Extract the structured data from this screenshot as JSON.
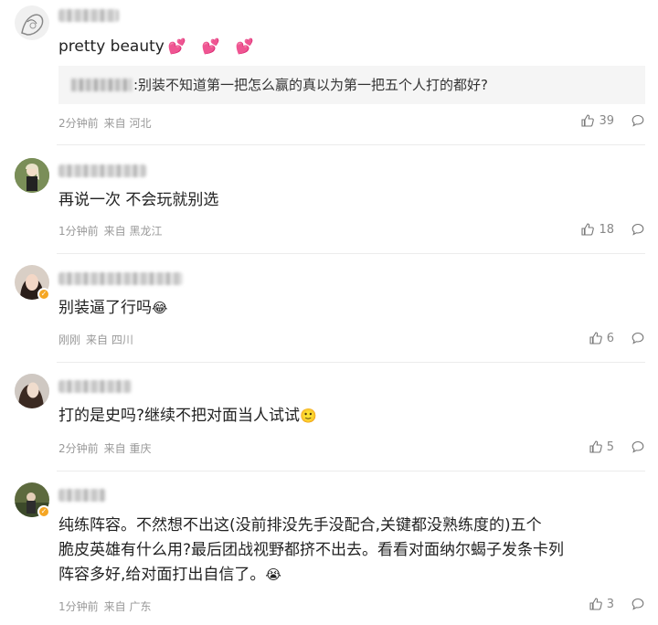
{
  "comments": [
    {
      "text": "pretty beauty",
      "hearts": "💕 💕 💕",
      "reply": ":别装不知道第一把怎么赢的真以为第一把五个人打的都好?",
      "time": "2分钟前",
      "from": "来自 河北",
      "likes": "39"
    },
    {
      "text": "再说一次 不会玩就别选",
      "time": "1分钟前",
      "from": "来自 黑龙江",
      "likes": "18"
    },
    {
      "text": "别装逼了行吗",
      "emoji": "😂",
      "time": "刚刚",
      "from": "来自 四川",
      "likes": "6"
    },
    {
      "text": "打的是史吗?继续不把对面当人试试",
      "emoji": "🙂",
      "time": "2分钟前",
      "from": "来自 重庆",
      "likes": "5"
    },
    {
      "text_lines": [
        "纯练阵容。不然想不出这(没前排没先手没配合,关键都没熟练度的)五个",
        "脆皮英雄有什么用?最后团战视野都挤不出去。看看对面纳尔蝎子发条卡列",
        "阵容多好,给对面打出自信了。"
      ],
      "emoji": "😭",
      "time": "1分钟前",
      "from": "来自 广东",
      "likes": "3"
    }
  ],
  "icons": {
    "like": "thumbs-up-icon",
    "reply": "comment-icon"
  },
  "colors": {
    "background": "#ffffff",
    "meta": "#999999",
    "badge": "#f5a623",
    "heart": "#e8507a"
  }
}
